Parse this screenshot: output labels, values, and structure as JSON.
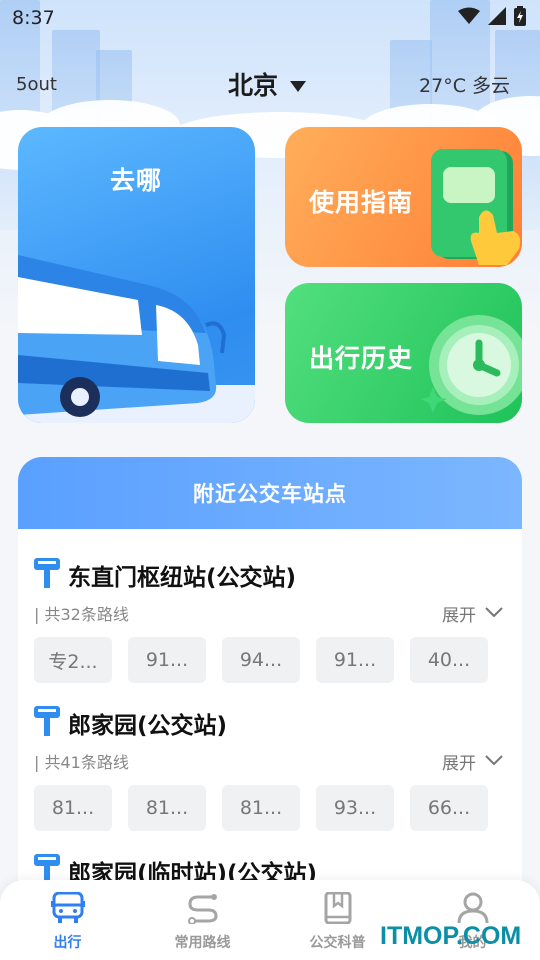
{
  "status_bar": {
    "time": "8:37"
  },
  "header": {
    "left_text": "5out",
    "city": "北京",
    "weather": "27°C  多云"
  },
  "cards": {
    "go": {
      "title": "去哪"
    },
    "guide": {
      "title": "使用指南"
    },
    "history": {
      "title": "出行历史"
    }
  },
  "nearby": {
    "title": "附近公交车站点",
    "stations": [
      {
        "name": "东直门枢纽站(公交站)",
        "route_count": "| 共32条路线",
        "expand": "展开",
        "routes": [
          "专2...",
          "91...",
          "94...",
          "91...",
          "40..."
        ]
      },
      {
        "name": "郎家园(公交站)",
        "route_count": "| 共41条路线",
        "expand": "展开",
        "routes": [
          "81...",
          "81...",
          "81...",
          "93...",
          "66..."
        ]
      },
      {
        "name": "郎家园(临时站)(公交站)"
      }
    ]
  },
  "tabbar": {
    "tabs": [
      {
        "label": "出行",
        "icon": "bus-icon"
      },
      {
        "label": "常用路线",
        "icon": "route-icon"
      },
      {
        "label": "公交科普",
        "icon": "book-icon"
      },
      {
        "label": "我的",
        "icon": "user-icon"
      }
    ]
  },
  "watermark": "ITMOP.COM",
  "colors": {
    "accent": "#2f7ff0",
    "guide_orange": "#ff8a3d",
    "history_green": "#2ccb63",
    "header_blue": "#5aa0ff"
  }
}
